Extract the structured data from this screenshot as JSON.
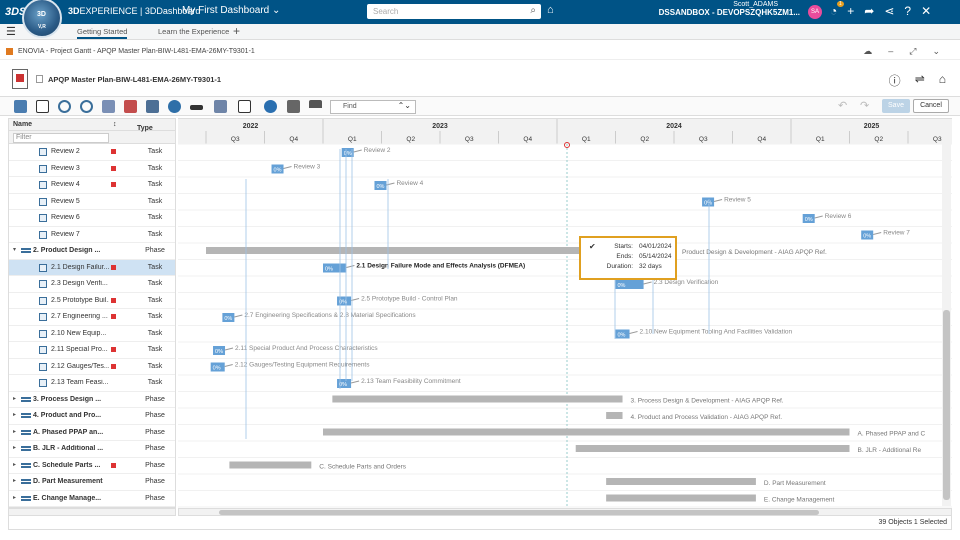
{
  "topbar": {
    "logo_text": "3DS",
    "compass_top": "3D",
    "compass_bottom": "V,R",
    "brand_prefix": "3D",
    "brand_rest": "EXPERIENCE | 3DDashboard",
    "dashboard": "My First Dashboard",
    "search_placeholder": "Search",
    "user_name": "Scott_ADAMS",
    "workspace": "DSSANDBOX - DEVOPSZQHK5ZM1...",
    "avatar_initials": "SA",
    "notification_count": "1"
  },
  "tabs": [
    {
      "label": "Getting Started"
    },
    {
      "label": "Learn the Experience"
    }
  ],
  "app": {
    "title": "ENOVIA - Project Gantt - APQP Master Plan-BIW-L481-EMA-26MY-T9301-1"
  },
  "object": {
    "title": "APQP Master Plan-BIW-L481-EMA-26MY-T9301-1"
  },
  "toolbar": {
    "find_placeholder": "Find",
    "save_label": "Save",
    "cancel_label": "Cancel"
  },
  "table": {
    "col_name": "Name",
    "filter_placeholder": "Filter",
    "col_type": "Type",
    "rows": [
      {
        "name": "Review 2",
        "type": "Task",
        "level": 2,
        "flag": true
      },
      {
        "name": "Review 3",
        "type": "Task",
        "level": 2,
        "flag": true
      },
      {
        "name": "Review 4",
        "type": "Task",
        "level": 2,
        "flag": true
      },
      {
        "name": "Review 5",
        "type": "Task",
        "level": 2,
        "flag": false
      },
      {
        "name": "Review 6",
        "type": "Task",
        "level": 2,
        "flag": false
      },
      {
        "name": "Review 7",
        "type": "Task",
        "level": 2,
        "flag": false
      },
      {
        "name": "2. Product Design ...",
        "type": "Phase",
        "level": 1,
        "flag": false,
        "bold": true,
        "expanded": true
      },
      {
        "name": "2.1 Design Failur...",
        "type": "Task",
        "level": 2,
        "flag": true,
        "selected": true
      },
      {
        "name": "2.3 Design Verifi...",
        "type": "Task",
        "level": 2,
        "flag": false
      },
      {
        "name": "2.5 Prototype Buil...",
        "type": "Task",
        "level": 2,
        "flag": true
      },
      {
        "name": "2.7 Engineering ...",
        "type": "Task",
        "level": 2,
        "flag": true
      },
      {
        "name": "2.10 New Equip...",
        "type": "Task",
        "level": 2,
        "flag": false
      },
      {
        "name": "2.11 Special Pro...",
        "type": "Task",
        "level": 2,
        "flag": true
      },
      {
        "name": "2.12 Gauges/Tes...",
        "type": "Task",
        "level": 2,
        "flag": true
      },
      {
        "name": "2.13 Team Feasi...",
        "type": "Task",
        "level": 2,
        "flag": false
      },
      {
        "name": "3. Process Design ...",
        "type": "Phase",
        "level": 1,
        "flag": false,
        "bold": true
      },
      {
        "name": "4. Product and Pro...",
        "type": "Phase",
        "level": 1,
        "flag": false,
        "bold": true
      },
      {
        "name": "A. Phased PPAP an...",
        "type": "Phase",
        "level": 1,
        "flag": false,
        "bold": true
      },
      {
        "name": "B. JLR - Additional ...",
        "type": "Phase",
        "level": 1,
        "flag": false,
        "bold": true
      },
      {
        "name": "C. Schedule Parts ...",
        "type": "Phase",
        "level": 1,
        "flag": true,
        "bold": true
      },
      {
        "name": "D. Part Measurement",
        "type": "Phase",
        "level": 1,
        "flag": false,
        "bold": true
      },
      {
        "name": "E. Change Manage...",
        "type": "Phase",
        "level": 1,
        "flag": false,
        "bold": true
      }
    ]
  },
  "timeline": {
    "years": [
      "2022",
      "2023",
      "2024",
      "2025"
    ],
    "quarters": [
      "Q3",
      "Q4",
      "Q1",
      "Q2",
      "Q3",
      "Q4",
      "Q1",
      "Q2",
      "Q3",
      "Q4",
      "Q1",
      "Q2",
      "Q3"
    ],
    "bars": [
      {
        "row": 0,
        "kind": "task",
        "pct": "0%",
        "label": "Review 2",
        "start": 2023.08,
        "end": 2023.08
      },
      {
        "row": 1,
        "kind": "task",
        "pct": "0%",
        "label": "Review 3",
        "start": 2022.78,
        "end": 2022.78
      },
      {
        "row": 2,
        "kind": "task",
        "pct": "0%",
        "label": "Review 4",
        "start": 2023.22,
        "end": 2023.22
      },
      {
        "row": 3,
        "kind": "task",
        "pct": "0%",
        "label": "Review 5",
        "start": 2024.62,
        "end": 2024.62
      },
      {
        "row": 4,
        "kind": "task",
        "pct": "0%",
        "label": "Review 6",
        "start": 2025.05,
        "end": 2025.05
      },
      {
        "row": 5,
        "kind": "task",
        "pct": "0%",
        "label": "Review 7",
        "start": 2025.3,
        "end": 2025.3
      },
      {
        "row": 6,
        "kind": "phase",
        "label": "Product Design & Development - AIAG APQP Ref.",
        "start": 2022.5,
        "end": 2024.5
      },
      {
        "row": 7,
        "kind": "task",
        "pct": "0%",
        "label": "2.1 Design Failure Mode and Effects Analysis (DFMEA)",
        "start": 2023.0,
        "end": 2023.1,
        "bold": true
      },
      {
        "row": 8,
        "kind": "task",
        "pct": "0%",
        "label": "2.3 Design Verification",
        "start": 2024.25,
        "end": 2024.37
      },
      {
        "row": 9,
        "kind": "task",
        "pct": "0%",
        "label": "2.5 Prototype Build - Control Plan",
        "start": 2023.06,
        "end": 2023.12
      },
      {
        "row": 10,
        "kind": "task",
        "pct": "0%",
        "label": "2.7 Engineering Specifications & 2.8 Material Specifications",
        "start": 2022.57,
        "end": 2022.62
      },
      {
        "row": 11,
        "kind": "task",
        "pct": "0%",
        "label": "2.10 New Equipment Tooling And Facilities Validation",
        "start": 2024.25,
        "end": 2024.31
      },
      {
        "row": 12,
        "kind": "task",
        "pct": "0%",
        "label": "2.11 Special Product And Process Characteristics",
        "start": 2022.53,
        "end": 2022.58
      },
      {
        "row": 13,
        "kind": "task",
        "pct": "0%",
        "label": "2.12 Gauges/Testing Equipment Requirements",
        "start": 2022.52,
        "end": 2022.58
      },
      {
        "row": 14,
        "kind": "task",
        "pct": "0%",
        "label": "2.13 Team Feasibility Commitment",
        "start": 2023.06,
        "end": 2023.12
      },
      {
        "row": 15,
        "kind": "phase",
        "label": "3. Process Design & Development - AIAG APQP Ref.",
        "start": 2023.04,
        "end": 2024.28
      },
      {
        "row": 16,
        "kind": "phase",
        "label": "4. Product and Process Validation - AIAG APQP Ref.",
        "start": 2024.21,
        "end": 2024.28
      },
      {
        "row": 17,
        "kind": "phase",
        "label": "A. Phased PPAP and C",
        "start": 2023.0,
        "end": 2025.25
      },
      {
        "row": 18,
        "kind": "phase",
        "label": "B. JLR - Additional Re",
        "start": 2024.08,
        "end": 2025.25
      },
      {
        "row": 19,
        "kind": "phase",
        "label": "C. Schedule Parts and Orders",
        "start": 2022.6,
        "end": 2022.95
      },
      {
        "row": 20,
        "kind": "phase",
        "label": "D. Part Measurement",
        "start": 2024.21,
        "end": 2024.85
      },
      {
        "row": 21,
        "kind": "phase",
        "label": "E. Change Management",
        "start": 2024.21,
        "end": 2024.85
      }
    ]
  },
  "tooltip": {
    "starts_label": "Starts:",
    "starts_value": "04/01/2024",
    "ends_label": "Ends:",
    "ends_value": "05/14/2024",
    "duration_label": "Duration:",
    "duration_value": "32 days"
  },
  "status": {
    "text": "39 Objects   1 Selected"
  },
  "colors": {
    "brand_blue": "#005386",
    "task_blue": "#4a90d0",
    "phase_gray": "#b5b5b5",
    "flag_red": "#d33333",
    "tooltip_border": "#e0a020"
  }
}
